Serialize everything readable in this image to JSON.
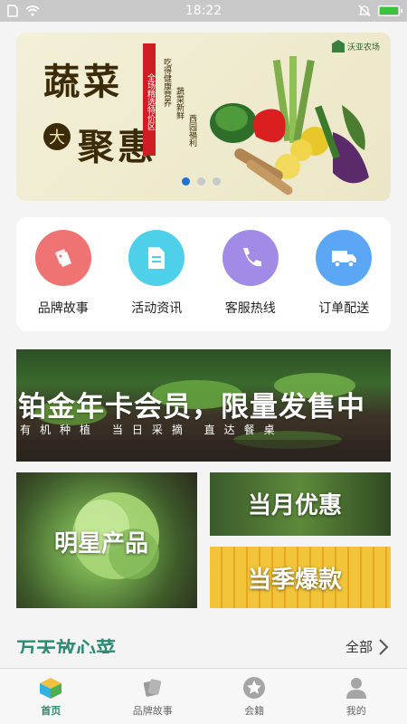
{
  "status_bar": {
    "time": "18:22"
  },
  "banner": {
    "title_line1": "蔬菜",
    "badge": "大",
    "title_line2": "聚惠",
    "red_strip": "全场精选特价区",
    "vertical_text_1": "吃得健康营养",
    "vertical_text_2": "蔬菜新鲜",
    "vertical_text_3": "西园福利",
    "logo_text": "沃亚农场",
    "slide_count": 3,
    "active_slide": 1
  },
  "quick_actions": [
    {
      "label": "品牌故事",
      "icon": "tags-icon",
      "color": "#f07373"
    },
    {
      "label": "活动资讯",
      "icon": "document-icon",
      "color": "#4fd0ea"
    },
    {
      "label": "客服热线",
      "icon": "phone-icon",
      "color": "#a28be6"
    },
    {
      "label": "订单配送",
      "icon": "truck-icon",
      "color": "#5ba6f5"
    }
  ],
  "promo_big": {
    "title": "铂金年卡会员，限量发售中",
    "subtitle": "有机种植  当日采摘  直达餐桌"
  },
  "tiles": {
    "star_product": "明星产品",
    "monthly_deal": "当月优惠",
    "season_hot": "当季爆款"
  },
  "section": {
    "title": "万天放心菜",
    "all_label": "全部"
  },
  "bottom_nav": [
    {
      "label": "首页",
      "icon": "home-cube-icon",
      "active": true
    },
    {
      "label": "品牌故事",
      "icon": "brand-cards-icon",
      "active": false
    },
    {
      "label": "会籍",
      "icon": "star-badge-icon",
      "active": false
    },
    {
      "label": "我的",
      "icon": "user-icon",
      "active": false
    }
  ],
  "colors": {
    "accent": "#2f8a73",
    "dot_active": "#1e72d1"
  }
}
